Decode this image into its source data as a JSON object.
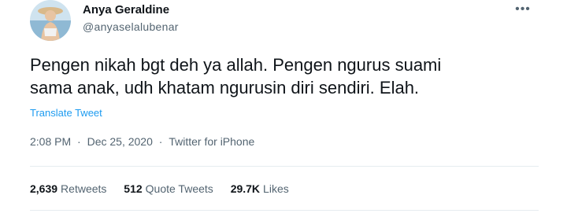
{
  "author": {
    "name": "Anya Geraldine",
    "handle": "@anyaselalubenar"
  },
  "more_icon": "more-horizontal-icon",
  "tweet": {
    "text": "Pengen nikah bgt deh ya allah. Pengen ngurus suami\nsama anak, udh khatam ngurusin diri sendiri. Elah.",
    "translate_label": "Translate Tweet"
  },
  "meta": {
    "time": "2:08 PM",
    "separator": "·",
    "date": "Dec 25, 2020",
    "source": "Twitter for iPhone"
  },
  "stats": {
    "retweets_count": "2,639",
    "retweets_label": "Retweets",
    "quotes_count": "512",
    "quotes_label": "Quote Tweets",
    "likes_count": "29.7K",
    "likes_label": "Likes"
  },
  "colors": {
    "accent": "#1d9bf0",
    "secondary_text": "#536471",
    "primary_text": "#0f1419"
  }
}
